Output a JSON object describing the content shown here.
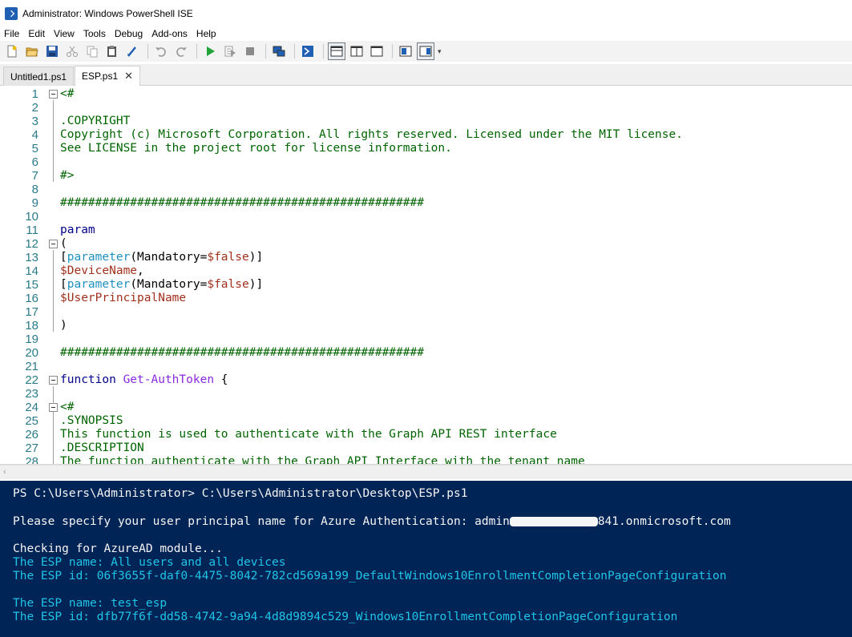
{
  "window": {
    "title": "Administrator: Windows PowerShell ISE"
  },
  "menu": [
    "File",
    "Edit",
    "View",
    "Tools",
    "Debug",
    "Add-ons",
    "Help"
  ],
  "toolbar": {
    "icons": [
      "new-icon",
      "open-icon",
      "save-icon",
      "cut-icon",
      "copy-icon",
      "paste-icon",
      "clear-console-icon",
      "undo-icon",
      "redo-icon",
      "run-icon",
      "run-selection-icon",
      "stop-icon",
      "remote-powershell-icon",
      "powershell-icon",
      "show-script-top-icon",
      "show-script-right-icon",
      "show-script-max-icon",
      "show-command-addon-icon",
      "show-script-pane-icon"
    ]
  },
  "tabs": [
    {
      "label": "Untitled1.ps1",
      "active": false
    },
    {
      "label": "ESP.ps1",
      "active": true,
      "close": "✕"
    }
  ],
  "editor": {
    "lines": [
      {
        "n": "1",
        "fold": true,
        "parts": [
          [
            "c-comment",
            "<#"
          ]
        ]
      },
      {
        "n": "2",
        "parts": []
      },
      {
        "n": "3",
        "parts": [
          [
            "c-comment",
            ".COPYRIGHT"
          ]
        ]
      },
      {
        "n": "4",
        "parts": [
          [
            "c-comment",
            "Copyright (c) Microsoft Corporation. All rights reserved. Licensed under the MIT license."
          ]
        ]
      },
      {
        "n": "5",
        "parts": [
          [
            "c-comment",
            "See LICENSE in the project root for license information."
          ]
        ]
      },
      {
        "n": "6",
        "parts": []
      },
      {
        "n": "7",
        "parts": [
          [
            "c-comment",
            "#>"
          ]
        ]
      },
      {
        "n": "8",
        "parts": []
      },
      {
        "n": "9",
        "parts": [
          [
            "c-comment",
            "####################################################"
          ]
        ]
      },
      {
        "n": "10",
        "parts": []
      },
      {
        "n": "11",
        "parts": [
          [
            "c-keyword",
            "param"
          ]
        ]
      },
      {
        "n": "12",
        "fold": true,
        "parts": [
          [
            "c-plain",
            "("
          ]
        ]
      },
      {
        "n": "13",
        "parts": [
          [
            "c-plain",
            "["
          ],
          [
            "c-type",
            "parameter"
          ],
          [
            "c-plain",
            "(Mandatory="
          ],
          [
            "c-var",
            "$false"
          ],
          [
            "c-plain",
            ")]"
          ]
        ]
      },
      {
        "n": "14",
        "parts": [
          [
            "c-var",
            "$DeviceName"
          ],
          [
            "c-plain",
            ","
          ]
        ]
      },
      {
        "n": "15",
        "parts": [
          [
            "c-plain",
            "["
          ],
          [
            "c-type",
            "parameter"
          ],
          [
            "c-plain",
            "(Mandatory="
          ],
          [
            "c-var",
            "$false"
          ],
          [
            "c-plain",
            ")]"
          ]
        ]
      },
      {
        "n": "16",
        "parts": [
          [
            "c-var",
            "$UserPrincipalName"
          ]
        ]
      },
      {
        "n": "17",
        "parts": []
      },
      {
        "n": "18",
        "parts": [
          [
            "c-plain",
            ")"
          ]
        ]
      },
      {
        "n": "19",
        "parts": []
      },
      {
        "n": "20",
        "parts": [
          [
            "c-comment",
            "####################################################"
          ]
        ]
      },
      {
        "n": "21",
        "parts": []
      },
      {
        "n": "22",
        "fold": true,
        "parts": [
          [
            "c-keyword",
            "function "
          ],
          [
            "c-func",
            "Get-AuthToken"
          ],
          [
            "c-plain",
            " {"
          ]
        ]
      },
      {
        "n": "23",
        "parts": []
      },
      {
        "n": "24",
        "fold": true,
        "parts": [
          [
            "c-comment",
            "<#"
          ]
        ]
      },
      {
        "n": "25",
        "parts": [
          [
            "c-comment",
            ".SYNOPSIS"
          ]
        ]
      },
      {
        "n": "26",
        "parts": [
          [
            "c-comment",
            "This function is used to authenticate with the Graph API REST interface"
          ]
        ]
      },
      {
        "n": "27",
        "parts": [
          [
            "c-comment",
            ".DESCRIPTION"
          ]
        ]
      },
      {
        "n": "28",
        "parts": [
          [
            "c-comment",
            "The function authenticate with the Graph API Interface with the tenant name"
          ]
        ]
      }
    ]
  },
  "console": {
    "lines": [
      {
        "cls": "con-white",
        "text": "PS C:\\Users\\Administrator> C:\\Users\\Administrator\\Desktop\\ESP.ps1"
      },
      {
        "cls": "con-white",
        "text": ""
      },
      {
        "cls": "con-white",
        "text_a": "Please specify your user principal name for Azure Authentication: admin",
        "redacted": true,
        "text_b": "841.onmicrosoft.com"
      },
      {
        "cls": "con-white",
        "text": ""
      },
      {
        "cls": "con-white",
        "text": "Checking for AzureAD module..."
      },
      {
        "cls": "con-cyan",
        "text": "The ESP name: All users and all devices"
      },
      {
        "cls": "con-cyan",
        "text": "The ESP id: 06f3655f-daf0-4475-8042-782cd569a199_DefaultWindows10EnrollmentCompletionPageConfiguration"
      },
      {
        "cls": "con-white",
        "text": ""
      },
      {
        "cls": "con-cyan",
        "text": "The ESP name: test_esp"
      },
      {
        "cls": "con-cyan",
        "text": "The ESP id: dfb77f6f-dd58-4742-9a94-4d8d9894c529_Windows10EnrollmentCompletionPageConfiguration"
      }
    ]
  }
}
